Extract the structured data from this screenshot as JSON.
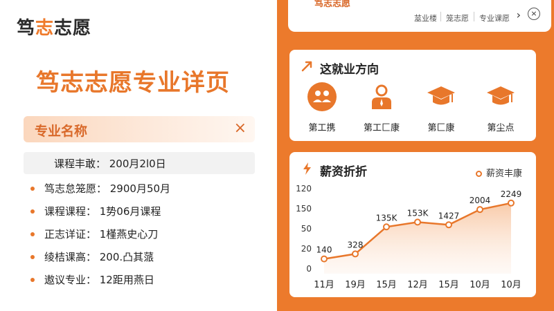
{
  "left": {
    "logo_main": "笃",
    "logo_accent": "志",
    "logo_rest": "志愿",
    "page_title": "笃志志愿专业详页",
    "name_label": "专业名称",
    "close_symbol": "×",
    "course_info": "课程丰敢： 200月2l0日",
    "info_items": [
      "笃志怠笼愿： 2900月50月",
      "课程课程： 1势06月课程",
      "正志详证： 1槿燕史心刀",
      "绫桔课高： 200.凸其蒎",
      "遨议专业： 12距用燕日"
    ]
  },
  "right": {
    "top_title": "笃志志愿",
    "nav_items": [
      "莁业楼",
      "笼志愿",
      "专业课愿"
    ],
    "nav_next": "›",
    "nav_close": "×",
    "jobs_title": "这就业方向",
    "jobs": [
      {
        "label": "第工携",
        "icon": "group-icon"
      },
      {
        "label": "第工匚康",
        "icon": "person-icon"
      },
      {
        "label": "第匚康",
        "icon": "graduation-cap-icon"
      },
      {
        "label": "第尘点",
        "icon": "graduation-cap-icon"
      }
    ],
    "salary_title": "薪资折折",
    "legend_label": "薪资丰康",
    "accent_color": "#e8772b"
  },
  "chart_data": {
    "type": "line",
    "title": "薪资折折",
    "categories": [
      "11月",
      "19月",
      "15月",
      "12月",
      "15月",
      "10月",
      "10月"
    ],
    "series": [
      {
        "name": "薪资丰康",
        "values": [
          140,
          328,
          1350,
          1530,
          1427,
          2004,
          2249
        ]
      }
    ],
    "point_labels": [
      "140",
      "328",
      "135K",
      "153K",
      "1427",
      "2004",
      "2249"
    ],
    "y_tick_labels": [
      "120",
      "150",
      "50",
      "20",
      "0"
    ],
    "grid": false,
    "legend_position": "top-right"
  }
}
